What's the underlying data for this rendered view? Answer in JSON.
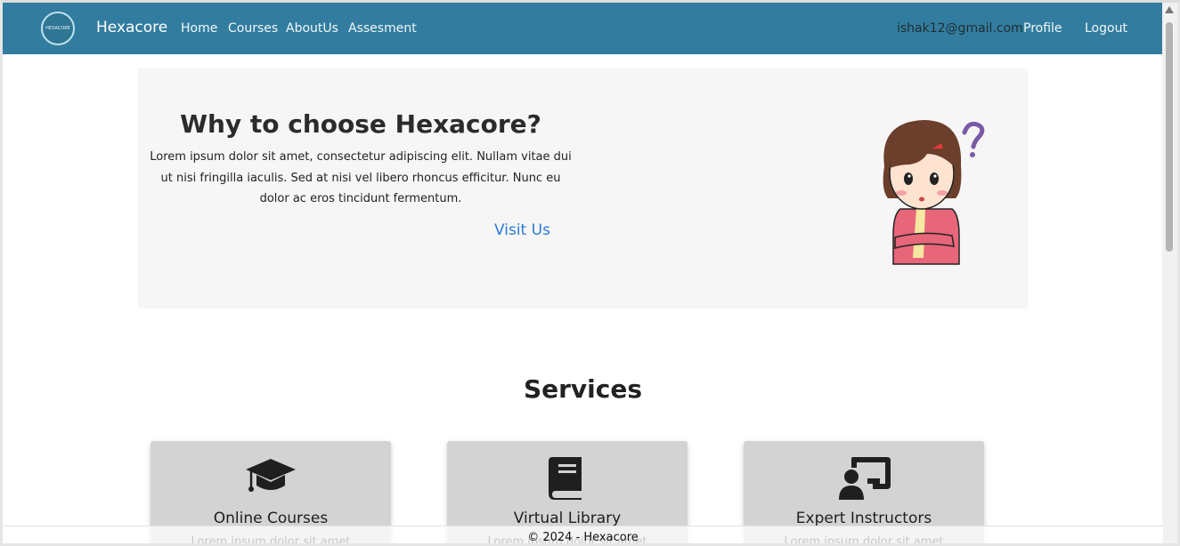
{
  "nav": {
    "logo_text": "HEXACORE",
    "brand": "Hexacore",
    "links": [
      "Home",
      "Courses",
      "AboutUs",
      "Assesment"
    ],
    "email": "ishak12@gmail.com",
    "profile": "Profile",
    "logout": "Logout"
  },
  "hero": {
    "title": "Why to choose Hexacore?",
    "text": "Lorem ipsum dolor sit amet, consectetur adipiscing elit. Nullam vitae dui ut nisi fringilla iaculis. Sed at nisi vel libero rhoncus efficitur. Nunc eu dolor ac eros tincidunt fermentum.",
    "link": "Visit Us"
  },
  "services": {
    "title": "Services",
    "cards": [
      {
        "title": "Online Courses",
        "text": "Lorem ipsum dolor sit amet",
        "icon": "graduation-cap-icon"
      },
      {
        "title": "Virtual Library",
        "text": "Lorem ipsum dolor sit amet",
        "icon": "book-icon"
      },
      {
        "title": "Expert Instructors",
        "text": "Lorem ipsum dolor sit amet",
        "icon": "instructor-icon"
      }
    ]
  },
  "footer": {
    "text": "© 2024 - Hexacore"
  },
  "colors": {
    "navbar": "#327d9f",
    "hero_bg": "#f6f6f6",
    "card_bg": "#d3d3d3",
    "link": "#2b7bd4"
  }
}
